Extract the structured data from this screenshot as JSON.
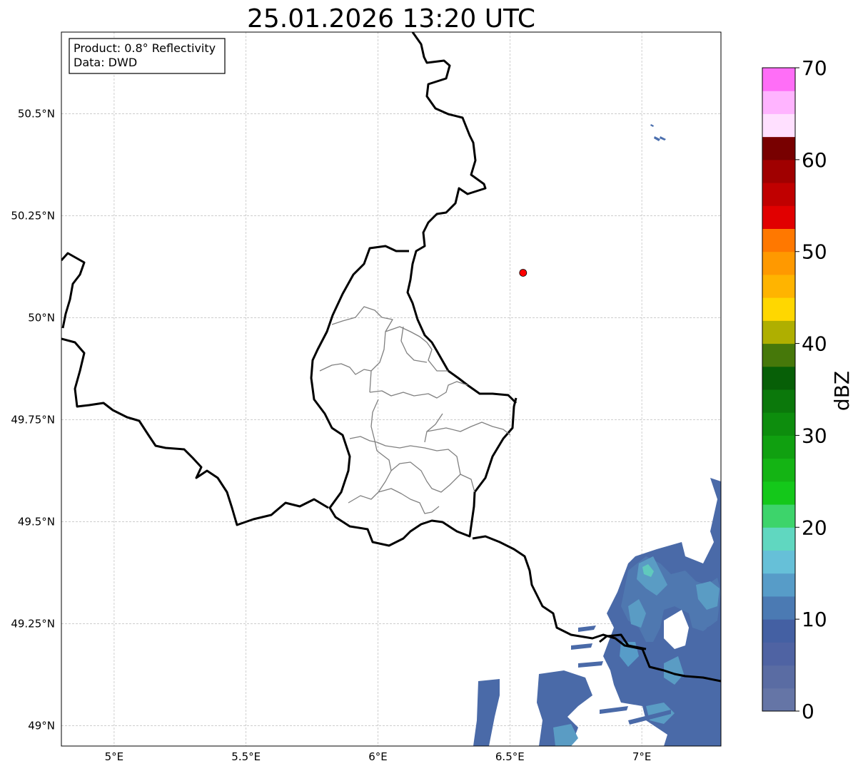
{
  "title": "25.01.2026 13:20 UTC",
  "info_box": {
    "line1": "Product: 0.8° Reflectivity",
    "line2": "Data: DWD"
  },
  "axes": {
    "lon_range": [
      4.8,
      7.3
    ],
    "lat_range": [
      48.95,
      50.7
    ],
    "lon_ticks": [
      {
        "value": 5.0,
        "label": "5°E"
      },
      {
        "value": 5.5,
        "label": "5.5°E"
      },
      {
        "value": 6.0,
        "label": "6°E"
      },
      {
        "value": 6.5,
        "label": "6.5°E"
      },
      {
        "value": 7.0,
        "label": "7°E"
      }
    ],
    "lat_ticks": [
      {
        "value": 50.5,
        "label": "50.5°N"
      },
      {
        "value": 50.25,
        "label": "50.25°N"
      },
      {
        "value": 50.0,
        "label": "50°N"
      },
      {
        "value": 49.75,
        "label": "49.75°N"
      },
      {
        "value": 49.5,
        "label": "49.5°N"
      },
      {
        "value": 49.25,
        "label": "49.25°N"
      },
      {
        "value": 49.0,
        "label": "49°N"
      }
    ],
    "grid": true
  },
  "marker": {
    "lon": 6.55,
    "lat": 50.11,
    "color": "#ff0000"
  },
  "colorbar": {
    "label": "dBZ",
    "min": 0,
    "max": 70,
    "step": 2.5,
    "ticks": [
      {
        "value": 0,
        "label": "0"
      },
      {
        "value": 10,
        "label": "10"
      },
      {
        "value": 20,
        "label": "20"
      },
      {
        "value": 30,
        "label": "30"
      },
      {
        "value": 40,
        "label": "40"
      },
      {
        "value": 50,
        "label": "50"
      },
      {
        "value": 60,
        "label": "60"
      },
      {
        "value": 70,
        "label": "70"
      }
    ],
    "colors": [
      "#6575a6",
      "#5a6ca3",
      "#4f63a3",
      "#4460a3",
      "#4b7ab3",
      "#579cc8",
      "#66c0d8",
      "#60d7c0",
      "#3dd46b",
      "#14c81a",
      "#14b414",
      "#10a010",
      "#0d8d0d",
      "#0b780b",
      "#075f07",
      "#46780a",
      "#afaf00",
      "#ffd700",
      "#ffb400",
      "#ff9900",
      "#ff7800",
      "#e10000",
      "#c00000",
      "#a00000",
      "#780000",
      "#ffe0ff",
      "#ffb4ff",
      "#ff6ef7",
      "#e633e6"
    ]
  },
  "chart_data": {
    "type": "heatmap",
    "title": "25.01.2026 13:20 UTC",
    "variable": "0.8° Reflectivity",
    "units": "dBZ",
    "source": "DWD",
    "xlim": [
      4.8,
      7.3
    ],
    "ylim": [
      48.95,
      50.7
    ],
    "echo_regions": [
      {
        "area": "SE corner, Saarland / Rhineland-Palatinate",
        "dBZ_range": [
          2,
          17
        ]
      },
      {
        "area": "small cells near 7.05°E 50.45°N",
        "dBZ_range": [
          3,
          8
        ]
      }
    ]
  }
}
